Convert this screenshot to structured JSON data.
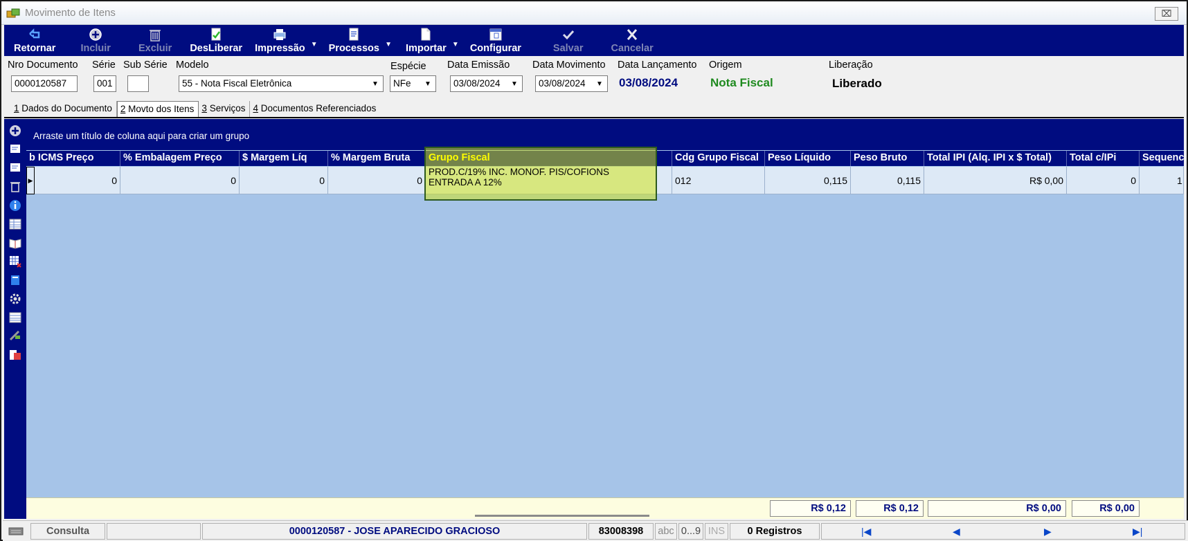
{
  "window": {
    "title": "Movimento de Itens",
    "close_symbol": "⌧"
  },
  "toolbar": {
    "retornar": "Retornar",
    "incluir": "Incluir",
    "excluir": "Excluir",
    "desliberar": "DesLiberar",
    "impressao": "Impressão",
    "processos": "Processos",
    "importar": "Importar",
    "configurar": "Configurar",
    "salvar": "Salvar",
    "cancelar": "Cancelar"
  },
  "header": {
    "nro_documento_label": "Nro Documento",
    "nro_documento": "0000120587",
    "serie_label": "Série",
    "serie": "001",
    "sub_serie_label": "Sub Série",
    "sub_serie": "",
    "modelo_label": "Modelo",
    "modelo": "55 - Nota Fiscal Eletrônica",
    "especie_label": "Espécie",
    "especie": "NFe",
    "data_emissao_label": "Data Emissão",
    "data_emissao": "03/08/2024",
    "data_movimento_label": "Data Movimento",
    "data_movimento": "03/08/2024",
    "data_lancamento_label": "Data Lançamento",
    "data_lancamento": "03/08/2024",
    "origem_label": "Origem",
    "origem": "Nota Fiscal",
    "liberacao_label": "Liberação",
    "liberacao": "Liberado"
  },
  "tabs": [
    {
      "num": "1",
      "label": " Dados do Documento"
    },
    {
      "num": "2",
      "label": " Movto dos Itens"
    },
    {
      "num": "3",
      "label": " Serviços"
    },
    {
      "num": "4",
      "label": " Documentos Referenciados"
    }
  ],
  "grid": {
    "group_hint": "Arraste um título de coluna aqui para criar um grupo",
    "columns": [
      "b ICMS Preço",
      "% Embalagem Preço",
      "$ Margem Líq",
      "% Margem Bruta",
      "Grupo Fiscal",
      "Cdg Grupo Fiscal",
      "Peso Líquido",
      "Peso Bruto",
      "Total IPI (Alq. IPI x $ Total)",
      "Total c/IPi",
      "Sequenc"
    ],
    "row": {
      "icms_preco": "0",
      "embalagem_preco": "0",
      "margem_liq": "0",
      "margem_bruta": "0",
      "grupo_fiscal": "PROD.C/19% INC. MONOF. PIS/COFIONS ENTRADA A 12%",
      "cdg_grupo_fiscal": "012",
      "peso_liquido": "0,115",
      "peso_bruto": "0,115",
      "total_ipi": "R$ 0,00",
      "total_c_ipi": "0",
      "sequencia": "1"
    },
    "totals": {
      "peso_liquido": "R$ 0,12",
      "peso_bruto": "R$ 0,12",
      "total_ipi": "R$ 0,00",
      "total_c_ipi": "R$ 0,00"
    }
  },
  "statusbar": {
    "mode": "Consulta",
    "document": "0000120587 - JOSE APARECIDO GRACIOSO",
    "code": "83008398",
    "abc": "abc",
    "num": "0...9",
    "ins": "INS",
    "registros": "0 Registros"
  },
  "colors": {
    "toolbar_bg": "#000c80",
    "grid_bg": "#a6c4e8",
    "origem": "#1f8a1f",
    "data_lancamento": "#000c80",
    "highlight": "#d2e61e"
  }
}
